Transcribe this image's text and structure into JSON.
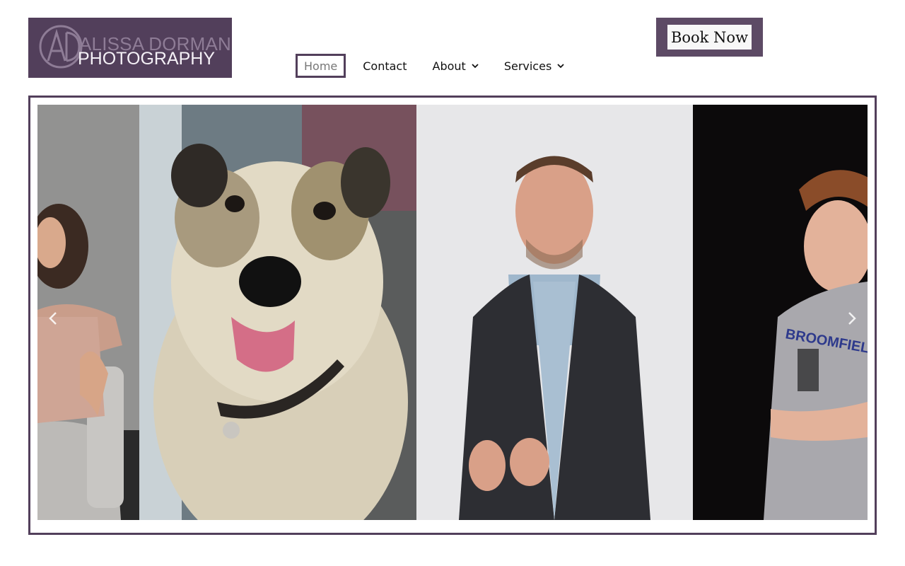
{
  "logo": {
    "line1": "ALISSA DORMAN",
    "line2": "PHOTOGRAPHY",
    "monogram_icon": "ad-monogram-icon"
  },
  "nav": {
    "items": [
      {
        "label": "Home",
        "active": true
      },
      {
        "label": "Contact"
      },
      {
        "label": "About",
        "dropdown": true
      },
      {
        "label": "Services",
        "dropdown": true
      }
    ]
  },
  "cta": {
    "label": "Book Now"
  },
  "carousel": {
    "slides": [
      {
        "subject": "girl-on-chair-photo"
      },
      {
        "subject": "scruffy-dog-photo"
      },
      {
        "subject": "man-in-blazer-photo"
      },
      {
        "subject": "teen-boy-tshirt-photo",
        "shirt_text": "BROOMFIELD"
      }
    ],
    "prev_icon": "chevron-left-icon",
    "next_icon": "chevron-right-icon"
  },
  "colors": {
    "brand": "#523f5b",
    "cta_border": "#5d4a65",
    "logo_line1": "#8e7c96"
  }
}
